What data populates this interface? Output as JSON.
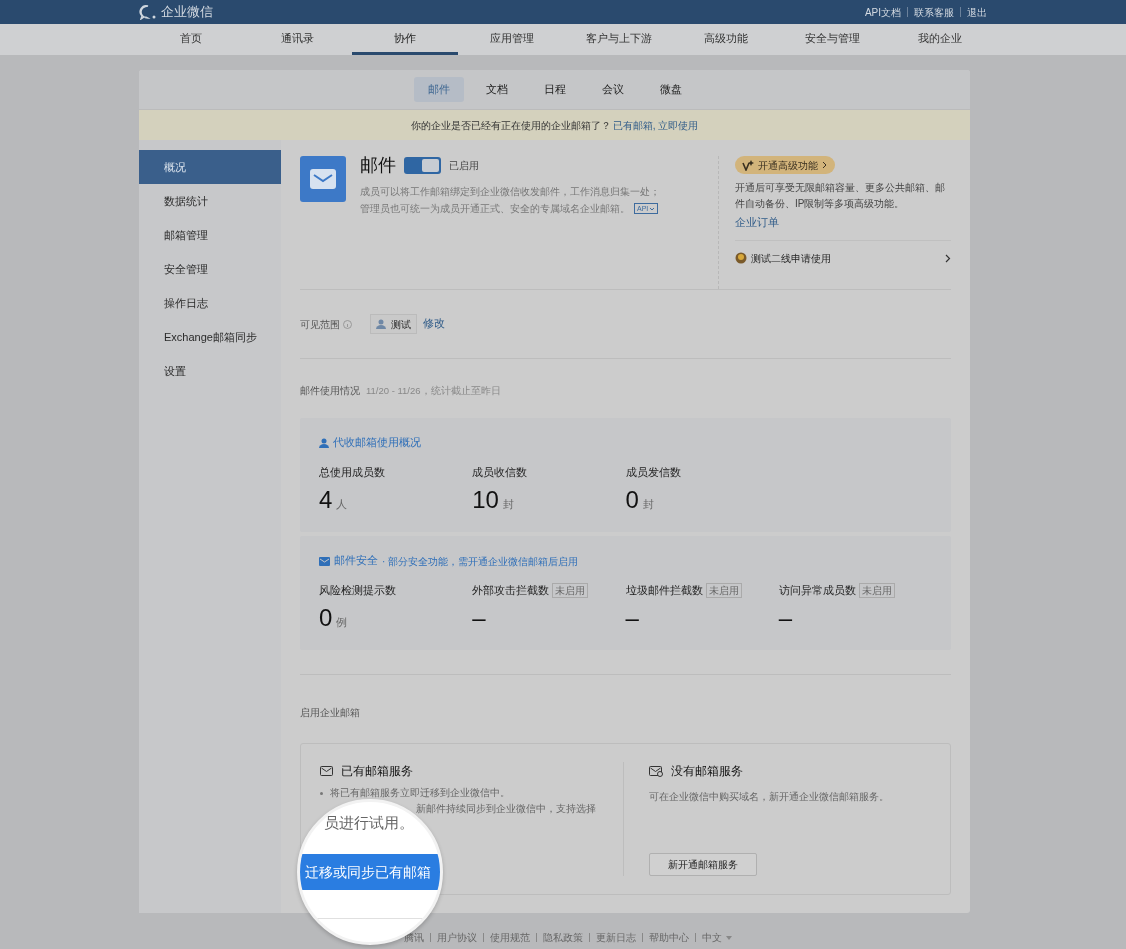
{
  "topbar": {
    "logo_text": "企业微信",
    "links": [
      "API文档",
      "联系客服",
      "退出"
    ]
  },
  "nav": [
    {
      "label": "首页",
      "selected": false
    },
    {
      "label": "通讯录",
      "selected": false
    },
    {
      "label": "协作",
      "selected": true
    },
    {
      "label": "应用管理",
      "selected": false
    },
    {
      "label": "客户与上下游",
      "selected": false
    },
    {
      "label": "高级功能",
      "selected": false
    },
    {
      "label": "安全与管理",
      "selected": false
    },
    {
      "label": "我的企业",
      "selected": false
    }
  ],
  "subtabs": [
    {
      "label": "邮件",
      "selected": true
    },
    {
      "label": "文档",
      "selected": false
    },
    {
      "label": "日程",
      "selected": false
    },
    {
      "label": "会议",
      "selected": false
    },
    {
      "label": "微盘",
      "selected": false
    }
  ],
  "banner": {
    "text": "你的企业是否已经有正在使用的企业邮箱了？",
    "link": "已有邮箱, 立即使用"
  },
  "sidebar": [
    {
      "label": "概况",
      "selected": true
    },
    {
      "label": "数据统计",
      "selected": false
    },
    {
      "label": "邮箱管理",
      "selected": false
    },
    {
      "label": "安全管理",
      "selected": false
    },
    {
      "label": "操作日志",
      "selected": false
    },
    {
      "label": "Exchange邮箱同步",
      "selected": false
    },
    {
      "label": "设置",
      "selected": false
    }
  ],
  "app": {
    "title": "邮件",
    "enabled": true,
    "status": "已启用",
    "description": [
      "成员可以将工作邮箱绑定到企业微信收发邮件，工作消息归集一处；",
      "管理员也可统一为成员开通正式、安全的专属域名企业邮箱。"
    ],
    "api_tag": "API"
  },
  "promo": {
    "button": "开通高级功能",
    "description": "开通后可享受无限邮箱容量、更多公共邮箱、邮件自动备份、IP限制等多项高级功能。",
    "link": "企业订单",
    "item": "测试二线申请使用"
  },
  "visibility": {
    "label": "可见范围",
    "member": "测试",
    "action": "修改"
  },
  "usage": {
    "title": "邮件使用情况",
    "period": "11/20 - 11/26，统计截止至昨日",
    "groups": [
      {
        "kind": "people",
        "title": "代收邮箱使用概况",
        "stats": [
          {
            "label": "总使用成员数",
            "value": "4",
            "unit": "人"
          },
          {
            "label": "成员收信数",
            "value": "10",
            "unit": "封"
          },
          {
            "label": "成员发信数",
            "value": "0",
            "unit": "封"
          }
        ]
      },
      {
        "kind": "mail",
        "title": "邮件安全",
        "note": "· 部分安全功能，需开通企业微信邮箱后启用",
        "stats": [
          {
            "label": "风险检测提示数",
            "value": "0",
            "unit": "例"
          },
          {
            "label": "外部攻击拦截数",
            "value": "–",
            "badge": "未启用"
          },
          {
            "label": "垃圾邮件拦截数",
            "value": "–",
            "badge": "未启用"
          },
          {
            "label": "访问异常成员数",
            "value": "–",
            "badge": "未启用"
          }
        ]
      }
    ]
  },
  "enable": {
    "title": "启用企业邮箱",
    "options": [
      {
        "kind": "existing",
        "title": "已有邮箱服务",
        "bullets": [
          "将已有邮箱服务立即迁移到企业微信中。",
          "新邮件持续同步到企业微信中，支持选择"
        ]
      },
      {
        "kind": "new",
        "title": "没有邮箱服务",
        "description": "可在企业微信中购买域名，新开通企业微信邮箱服务。",
        "button": "新开通邮箱服务"
      }
    ]
  },
  "magnifier": {
    "line": "员进行试用。",
    "button": "迁移或同步已有邮箱"
  },
  "footer": {
    "links": [
      "腾讯",
      "用户协议",
      "使用规范",
      "隐私政策",
      "更新日志",
      "帮助中心"
    ],
    "language": "中文"
  }
}
